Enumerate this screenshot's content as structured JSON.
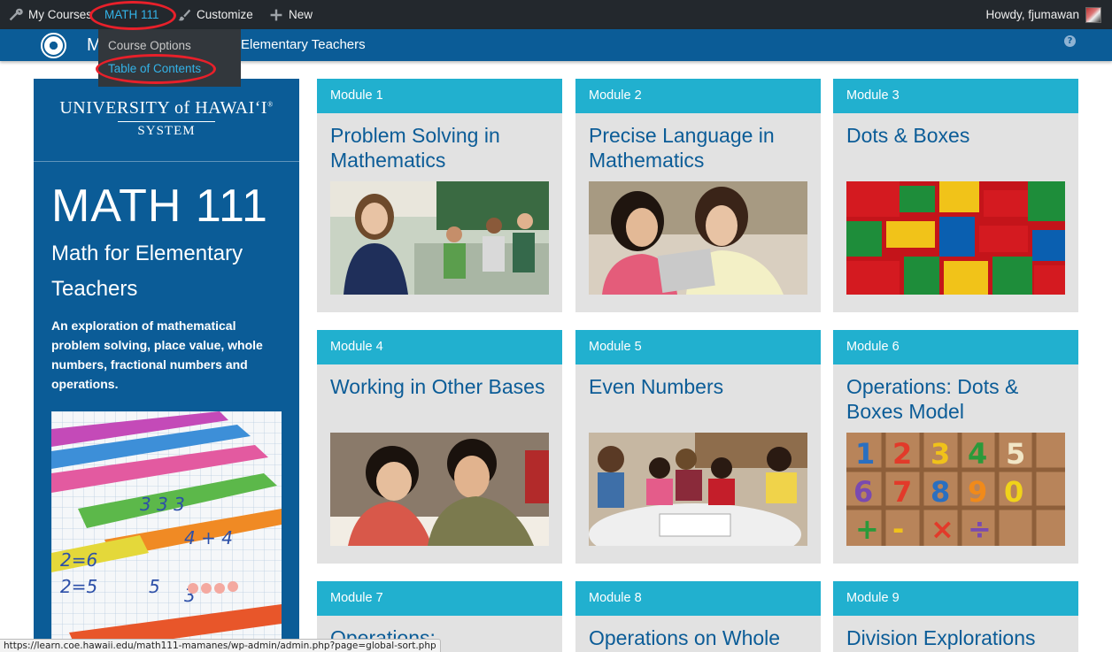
{
  "admin_bar": {
    "my_courses": "My Courses",
    "current_course": "MATH 111",
    "customize": "Customize",
    "new": "New",
    "howdy": "Howdy, fjumawan"
  },
  "dropdown": {
    "items": [
      "Course Options",
      "Table of Contents"
    ]
  },
  "header": {
    "title_first": "M",
    "title_rest": "Elementary Teachers",
    "help": "?"
  },
  "sidebar": {
    "logo_name": "UNIVERSITY of HAWAIʻI",
    "logo_reg": "®",
    "logo_system": "SYSTEM",
    "course_code": "MATH 111",
    "course_title": "Math for Elementary Teachers",
    "description": "An exploration of mathematical problem solving, place value, whole numbers, fractional numbers and operations."
  },
  "modules": [
    {
      "label": "Module 1",
      "title": "Problem Solving in Mathematics"
    },
    {
      "label": "Module 2",
      "title": "Precise Language in Mathematics"
    },
    {
      "label": "Module 3",
      "title": "Dots & Boxes"
    },
    {
      "label": "Module 4",
      "title": "Working in Other Bases"
    },
    {
      "label": "Module 5",
      "title": "Even Numbers"
    },
    {
      "label": "Module 6",
      "title": "Operations: Dots & Boxes Model"
    },
    {
      "label": "Module 7",
      "title": "Operations:"
    },
    {
      "label": "Module 8",
      "title": "Operations on Whole"
    },
    {
      "label": "Module 9",
      "title": "Division Explorations"
    }
  ],
  "status_bar": {
    "url": "https://learn.coe.hawaii.edu/math111-mamanes/wp-admin/admin.php?page=global-sort.php"
  },
  "colors": {
    "admin_bar": "#23282d",
    "brand_blue": "#0b5c97",
    "module_header": "#21b0cf",
    "highlight_circle": "#e8202a",
    "active_link": "#33b3e8"
  }
}
